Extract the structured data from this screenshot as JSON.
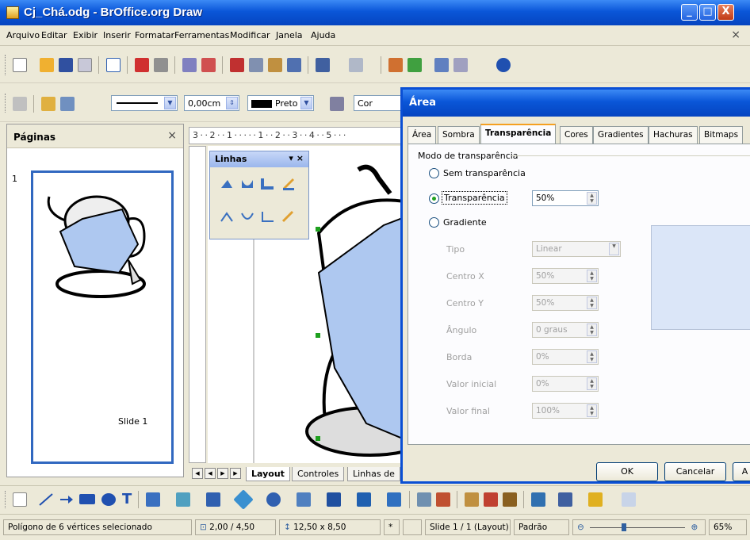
{
  "window": {
    "title": "Cj_Chá.odg - BrOffice.org Draw",
    "minimize": "_",
    "maximize": "□",
    "close": "X"
  },
  "menubar": {
    "items": [
      "Arquivo",
      "Editar",
      "Exibir",
      "Inserir",
      "Formatar",
      "Ferramentas",
      "Modificar",
      "Janela",
      "Ajuda"
    ],
    "close": "×"
  },
  "line_toolbar": {
    "line_width": "0,00cm",
    "color": "Preto",
    "area_style": "Cor"
  },
  "pages_panel": {
    "title": "Páginas",
    "close": "×",
    "slide_number": "1",
    "slide_label": "Slide 1"
  },
  "ruler": {
    "text": "3 · · 2 · · 1 · · · · · 1 · · 2 · · 3 · · 4 · · 5 · · ·"
  },
  "linhas_toolbar": {
    "title": "Linhas",
    "controls": "▾ ×"
  },
  "bottom_tabs": {
    "tabs": [
      "Layout",
      "Controles",
      "Linhas de"
    ]
  },
  "status": {
    "message": "Polígono de 6 vértices selecionado",
    "position": "2,00 / 4,50",
    "size": "12,50 x 8,50",
    "modified": "*",
    "slide_info": "Slide 1 / 1 (Layout)",
    "layout": "Padrão",
    "zoom": "65%"
  },
  "dialog": {
    "title": "Área",
    "tabs": [
      "Área",
      "Sombra",
      "Transparência",
      "Cores",
      "Gradientes",
      "Hachuras",
      "Bitmaps"
    ],
    "active_tab": "Transparência",
    "group_title": "Modo de transparência",
    "options": {
      "none": "Sem transparência",
      "transparency": "Transparência",
      "gradient": "Gradiente"
    },
    "transparency_value": "50%",
    "fields": [
      {
        "label": "Tipo",
        "value": "Linear"
      },
      {
        "label": "Centro X",
        "value": "50%"
      },
      {
        "label": "Centro Y",
        "value": "50%"
      },
      {
        "label": "Ângulo",
        "value": "0 graus"
      },
      {
        "label": "Borda",
        "value": "0%"
      },
      {
        "label": "Valor inicial",
        "value": "0%"
      },
      {
        "label": "Valor final",
        "value": "100%"
      }
    ],
    "buttons": {
      "ok": "OK",
      "cancel": "Cancelar",
      "help": "A"
    }
  },
  "colors": {
    "xp_blue": "#0a56d8",
    "shape_fill": "#aec8f0",
    "selection_handle": "#1ea01e"
  },
  "icons": [
    "app-icon",
    "new-icon",
    "open-icon",
    "save-icon",
    "mail-icon",
    "edit-icon",
    "pdf-icon",
    "print-icon",
    "spellcheck-icon",
    "autospell-icon",
    "cut-icon",
    "copy-icon",
    "paste-icon",
    "format-paintbrush-icon",
    "undo-icon",
    "redo-icon",
    "chart-icon",
    "navigator-icon",
    "draw-functions-icon",
    "zoom-icon",
    "help-icon"
  ]
}
